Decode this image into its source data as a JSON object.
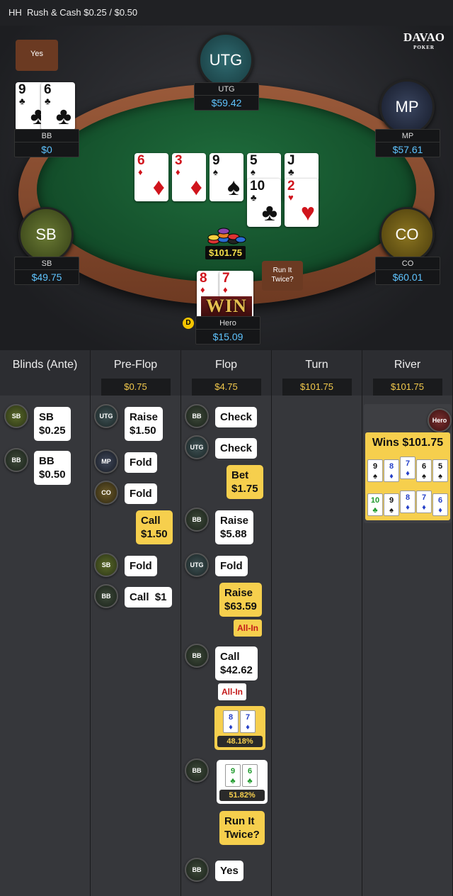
{
  "topbar": {
    "label": "HH",
    "title": "Rush & Cash $0.25 / $0.50"
  },
  "logo": {
    "main": "DAVAO",
    "sub": "POKER"
  },
  "seats": {
    "utg": {
      "badge": "UTG",
      "name": "UTG",
      "stack": "$59.42"
    },
    "mp": {
      "badge": "MP",
      "name": "MP",
      "stack": "$57.61"
    },
    "co": {
      "badge": "CO",
      "name": "CO",
      "stack": "$60.01"
    },
    "sb": {
      "badge": "SB",
      "name": "SB",
      "stack": "$49.75"
    },
    "bb": {
      "name": "BB",
      "stack": "$0"
    },
    "hero": {
      "name": "Hero",
      "stack": "$15.09"
    }
  },
  "bubbles": {
    "bb_yes": "Yes",
    "hero_run": "Run It Twice?"
  },
  "pot": "$101.75",
  "win_label": "WIN",
  "dealer": "D",
  "board_top": [
    {
      "r": "6",
      "s": "♦",
      "c": "red"
    },
    {
      "r": "3",
      "s": "♦",
      "c": "red"
    },
    {
      "r": "9",
      "s": "♠",
      "c": "blk"
    },
    {
      "r": "5",
      "s": "♠",
      "c": "blk"
    },
    {
      "r": "J",
      "s": "♣",
      "c": "blk"
    }
  ],
  "board_bottom": [
    {
      "r": "10",
      "s": "♣",
      "c": "blk"
    },
    {
      "r": "2",
      "s": "♥",
      "c": "red"
    }
  ],
  "bb_cards": [
    {
      "r": "9",
      "s": "♣",
      "c": "blk"
    },
    {
      "r": "6",
      "s": "♣",
      "c": "blk"
    }
  ],
  "hero_cards": [
    {
      "r": "8",
      "s": "♦",
      "c": "red"
    },
    {
      "r": "7",
      "s": "♦",
      "c": "red"
    }
  ],
  "history": {
    "columns": [
      {
        "title": "Blinds (Ante)",
        "pot": ""
      },
      {
        "title": "Pre-Flop",
        "pot": "$0.75"
      },
      {
        "title": "Flop",
        "pot": "$4.75"
      },
      {
        "title": "Turn",
        "pot": "$101.75"
      },
      {
        "title": "River",
        "pot": "$101.75"
      }
    ],
    "blinds": [
      {
        "badge": "SB",
        "text": "SB\n$0.25"
      },
      {
        "badge": "BB",
        "text": "BB\n$0.50"
      }
    ],
    "preflop": [
      {
        "badge": "UTG",
        "text": "Raise\n$1.50"
      },
      {
        "badge": "MP",
        "text": "Fold"
      },
      {
        "badge": "CO",
        "text": "Fold"
      },
      {
        "badge": "",
        "text": "Call\n$1.50",
        "hero": true
      },
      {
        "badge": "SB",
        "text": "Fold"
      },
      {
        "badge": "BB",
        "text": "Call  $1"
      }
    ],
    "flop": {
      "bb_check": "Check",
      "utg_check": "Check",
      "hero_bet": "Bet\n$1.75",
      "bb_raise": "Raise\n$5.88",
      "utg_fold": "Fold",
      "hero_raise": "Raise\n$63.59",
      "allin": "All-In",
      "bb_call": "Call\n$42.62",
      "hero_eq": "48.18%",
      "bb_eq": "51.82%",
      "hero_run": "Run It\nTwice?",
      "bb_yes": "Yes",
      "badges": {
        "bb": "BB",
        "utg": "UTG"
      }
    },
    "river": {
      "badge": "Hero",
      "wins": "Wins $101.75",
      "row1": [
        {
          "r": "9",
          "s": "♠",
          "c": "blk"
        },
        {
          "r": "8",
          "s": "♦",
          "c": "blu"
        },
        {
          "r": "7",
          "s": "♦",
          "c": "blu"
        },
        {
          "r": "6",
          "s": "♠",
          "c": "blk"
        },
        {
          "r": "5",
          "s": "♠",
          "c": "blk"
        }
      ],
      "row2": [
        {
          "r": "10",
          "s": "♣",
          "c": "grn"
        },
        {
          "r": "9",
          "s": "♠",
          "c": "blk"
        },
        {
          "r": "8",
          "s": "♦",
          "c": "blu"
        },
        {
          "r": "7",
          "s": "♦",
          "c": "blu"
        },
        {
          "r": "6",
          "s": "♦",
          "c": "blu"
        }
      ]
    },
    "mini_hero": [
      {
        "r": "8",
        "s": "♦",
        "c": "blu"
      },
      {
        "r": "7",
        "s": "♦",
        "c": "blu"
      }
    ],
    "mini_bb": [
      {
        "r": "9",
        "s": "♣",
        "c": "grn"
      },
      {
        "r": "6",
        "s": "♣",
        "c": "grn"
      }
    ]
  },
  "colors": {
    "stack": "#5fc4ff",
    "pot": "#f6e04a",
    "hero_action": "#f6cf4d",
    "allin": "#c41a1a"
  }
}
